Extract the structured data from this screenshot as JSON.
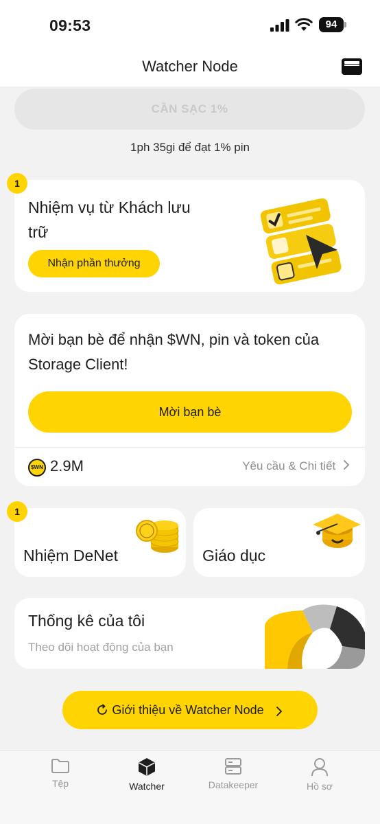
{
  "status_bar": {
    "time": "09:53",
    "battery": "94"
  },
  "header": {
    "title": "Watcher Node"
  },
  "charge": {
    "button_label": "CẦN SẠC 1%",
    "note": "1ph 35gi để đạt 1% pin"
  },
  "tasks_card": {
    "badge": "1",
    "title": "Nhiệm vụ từ Khách lưu trữ",
    "button_label": "Nhận phần thưởng"
  },
  "invite_card": {
    "text": "Mời bạn bè để nhận $WN, pin và token của Storage Client!",
    "button_label": "Mời bạn bè",
    "coin_label": "$WN",
    "amount": "2.9M",
    "details_label": "Yêu cầu & Chi tiết"
  },
  "denet_card": {
    "badge": "1",
    "title": "Nhiệm DeNet"
  },
  "education_card": {
    "title": "Giáo dục"
  },
  "stats_card": {
    "title": "Thống kê của tôi",
    "subtitle": "Theo dõi hoạt động của bạn"
  },
  "about_button": {
    "label": "Giới thiệu về Watcher Node"
  },
  "tab_bar": {
    "tabs": [
      {
        "label": "Tệp",
        "icon": "folder-icon"
      },
      {
        "label": "Watcher",
        "icon": "cube-icon"
      },
      {
        "label": "Datakeeper",
        "icon": "server-icon"
      },
      {
        "label": "Hồ sơ",
        "icon": "person-icon"
      }
    ],
    "active": "Watcher"
  },
  "colors": {
    "accent": "#ffd400",
    "background": "#f2f2f2",
    "card": "#ffffff",
    "muted_text": "#a0a0a0"
  }
}
